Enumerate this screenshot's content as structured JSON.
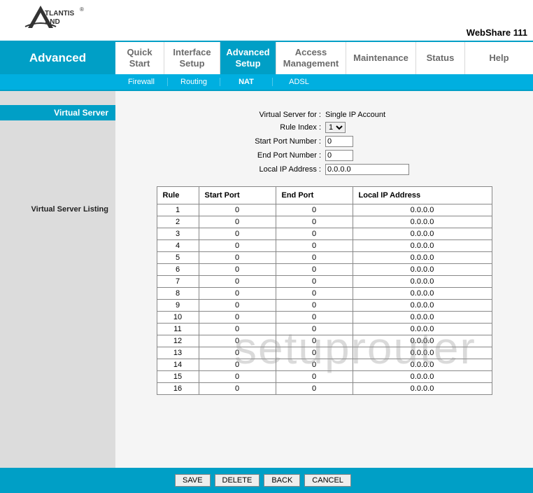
{
  "product": "WebShare 111",
  "nav": {
    "advanced": "Advanced",
    "items": [
      {
        "line1": "Quick",
        "line2": "Start"
      },
      {
        "line1": "Interface",
        "line2": "Setup"
      },
      {
        "line1": "Advanced",
        "line2": "Setup"
      },
      {
        "line1": "Access",
        "line2": "Management"
      },
      {
        "line1": "Maintenance",
        "line2": ""
      },
      {
        "line1": "Status",
        "line2": ""
      },
      {
        "line1": "Help",
        "line2": ""
      }
    ]
  },
  "subnav": {
    "firewall": "Firewall",
    "routing": "Routing",
    "nat": "NAT",
    "adsl": "ADSL"
  },
  "side": {
    "head": "Virtual Server",
    "listing": "Virtual Server Listing"
  },
  "form": {
    "vs_for_lbl": "Virtual Server for :",
    "vs_for_val": "Single IP Account",
    "rule_lbl": "Rule Index :",
    "rule_val": "1",
    "start_lbl": "Start Port Number :",
    "start_val": "0",
    "end_lbl": "End Port Number :",
    "end_val": "0",
    "ip_lbl": "Local IP Address :",
    "ip_val": "0.0.0.0"
  },
  "table": {
    "h_rule": "Rule",
    "h_start": "Start Port",
    "h_end": "End Port",
    "h_ip": "Local IP Address",
    "rows": [
      {
        "rule": "1",
        "start": "0",
        "end": "0",
        "ip": "0.0.0.0"
      },
      {
        "rule": "2",
        "start": "0",
        "end": "0",
        "ip": "0.0.0.0"
      },
      {
        "rule": "3",
        "start": "0",
        "end": "0",
        "ip": "0.0.0.0"
      },
      {
        "rule": "4",
        "start": "0",
        "end": "0",
        "ip": "0.0.0.0"
      },
      {
        "rule": "5",
        "start": "0",
        "end": "0",
        "ip": "0.0.0.0"
      },
      {
        "rule": "6",
        "start": "0",
        "end": "0",
        "ip": "0.0.0.0"
      },
      {
        "rule": "7",
        "start": "0",
        "end": "0",
        "ip": "0.0.0.0"
      },
      {
        "rule": "8",
        "start": "0",
        "end": "0",
        "ip": "0.0.0.0"
      },
      {
        "rule": "9",
        "start": "0",
        "end": "0",
        "ip": "0.0.0.0"
      },
      {
        "rule": "10",
        "start": "0",
        "end": "0",
        "ip": "0.0.0.0"
      },
      {
        "rule": "11",
        "start": "0",
        "end": "0",
        "ip": "0.0.0.0"
      },
      {
        "rule": "12",
        "start": "0",
        "end": "0",
        "ip": "0.0.0.0"
      },
      {
        "rule": "13",
        "start": "0",
        "end": "0",
        "ip": "0.0.0.0"
      },
      {
        "rule": "14",
        "start": "0",
        "end": "0",
        "ip": "0.0.0.0"
      },
      {
        "rule": "15",
        "start": "0",
        "end": "0",
        "ip": "0.0.0.0"
      },
      {
        "rule": "16",
        "start": "0",
        "end": "0",
        "ip": "0.0.0.0"
      }
    ]
  },
  "buttons": {
    "save": "SAVE",
    "delete": "DELETE",
    "back": "BACK",
    "cancel": "CANCEL"
  },
  "watermark": "setuprouter"
}
